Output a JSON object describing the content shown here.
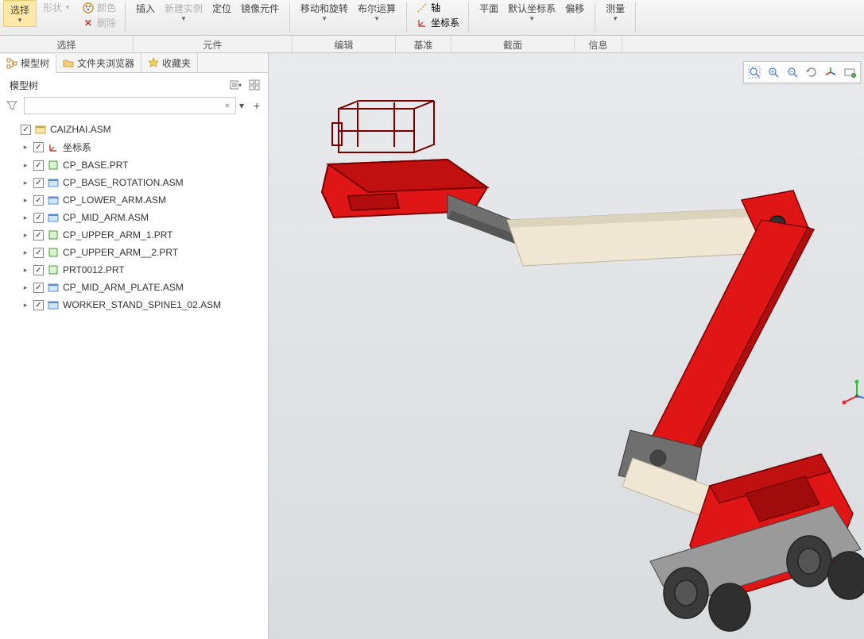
{
  "ribbon": {
    "select_btn": "选择",
    "shape_btn": "形状",
    "color_btn": "颜色",
    "delete_btn": "删除",
    "insert_btn": "插入",
    "newinst_btn": "新建实例",
    "locate_btn": "定位",
    "mirror_btn": "镜像元件",
    "moverot_btn": "移动和旋转",
    "boolean_btn": "布尔运算",
    "axis_btn": "轴",
    "coord_btn": "坐标系",
    "plane_btn": "平面",
    "defcoord_btn": "默认坐标系",
    "offset_btn": "偏移",
    "measure_btn": "测量"
  },
  "ribbon_groups": {
    "g_select": "选择",
    "g_component": "元件",
    "g_edit": "编辑",
    "g_datum": "基准",
    "g_section": "截面",
    "g_info": "信息"
  },
  "left_tabs": {
    "model_tree": "模型树",
    "folder_browser": "文件夹浏览器",
    "favorites": "收藏夹"
  },
  "sidebar": {
    "title": "模型树",
    "filter_placeholder": ""
  },
  "tree": {
    "root": "CAIZHAI.ASM",
    "items": [
      "坐标系",
      "CP_BASE.PRT",
      "CP_BASE_ROTATION.ASM",
      "CP_LOWER_ARM.ASM",
      "CP_MID_ARM.ASM",
      "CP_UPPER_ARM_1.PRT",
      "CP_UPPER_ARM__2.PRT",
      "PRT0012.PRT",
      "CP_MID_ARM_PLATE.ASM",
      "WORKER_STAND_SPINE1_02.ASM"
    ]
  },
  "icons": {
    "select": "select-icon",
    "delete_x": "✕"
  }
}
